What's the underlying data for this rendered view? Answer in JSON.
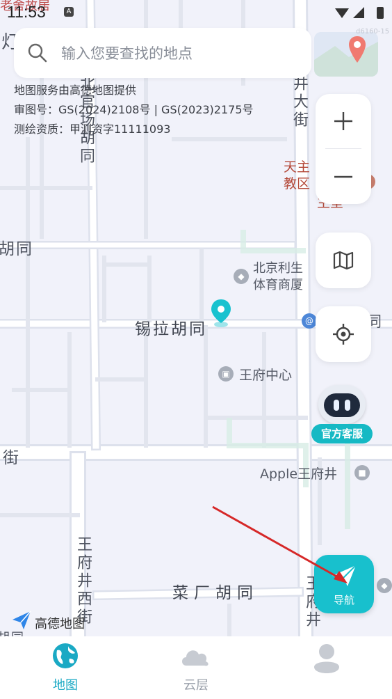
{
  "status_bar": {
    "time": "11:53"
  },
  "search": {
    "placeholder": "输入您要查找的地点",
    "tag": "d6160-15"
  },
  "attribution": {
    "line1": "地图服务由高德地图提供",
    "line2": "审图号：GS(2024)2108号 | GS(2023)2175号",
    "line3": "测绘资质：甲测资字11111093"
  },
  "map_labels": {
    "top_poi": "老舍故居",
    "left_edge_1": "灯",
    "left_edge_2": "胡同",
    "left_edge_3": "街",
    "left_edge_4": "胡同",
    "vertical_road_1": "北官场胡同",
    "vertical_road_2": "井大街",
    "vertical_road_3": "王府井西街",
    "vertical_road_4": "王府井",
    "church": "天主教区",
    "church_2": "主堂",
    "sports_mall": "北京利生体育商厦",
    "road_xila": "锡拉胡同",
    "right_hutong": "同",
    "wangfu_center": "王府中心",
    "apple_store": "Apple王府井",
    "caichang": "菜厂胡同"
  },
  "controls": {
    "zoom_in": "+",
    "zoom_out": "−",
    "layers_icon": "map-icon",
    "locate_icon": "crosshair-icon"
  },
  "service": {
    "label": "官方客服"
  },
  "navigate": {
    "label": "导航"
  },
  "logo": {
    "text": "高德地图"
  },
  "bottom_nav": {
    "tabs": [
      {
        "label": "地图",
        "icon": "globe-icon",
        "active": true
      },
      {
        "label": "云层",
        "icon": "cloud-icon",
        "active": false
      },
      {
        "label": "",
        "icon": "profile-icon",
        "active": false
      }
    ]
  },
  "colors": {
    "accent": "#18c0cd",
    "active_tab": "#1aa9c4",
    "arrow": "#d62828"
  }
}
